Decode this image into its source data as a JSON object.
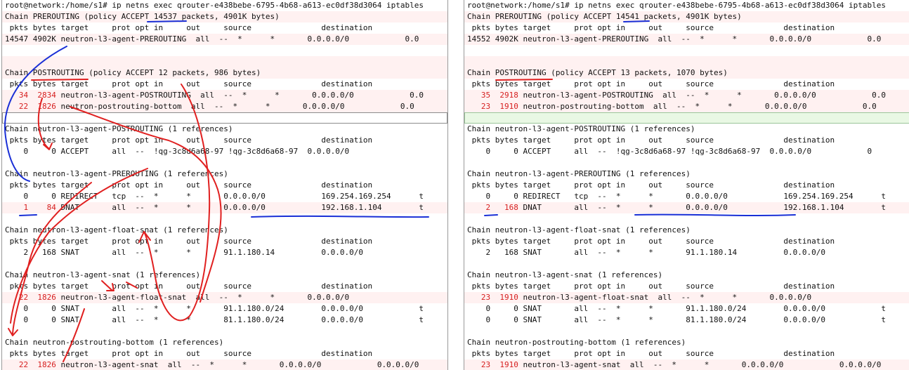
{
  "colors": {
    "row_alt": "#fff1f1",
    "text": "#111111",
    "red_numbers": "#d62020",
    "annotation_red": "#e02020",
    "annotation_blue": "#1a2fd6",
    "cursor_green": "#e9f8e4"
  },
  "left": {
    "lines": [
      "root@network:/home/s1# ip netns exec qrouter-e438bebe-6795-4b68-a613-ec0df38d3064 iptables",
      "Chain PREROUTING (policy ACCEPT 14537 packets, 4901K bytes)",
      " pkts bytes target     prot opt in     out     source               destination",
      "14547 4902K neutron-l3-agent-PREROUTING  all  --  *      *       0.0.0.0/0            0.0",
      "",
      "",
      "Chain POSTROUTING (policy ACCEPT 12 packets, 986 bytes)",
      " pkts bytes target     prot opt in     out     source               destination",
      "   34  2834 neutron-l3-agent-POSTROUTING  all  --  *      *       0.0.0.0/0            0.0",
      "   22  1826 neutron-postrouting-bottom  all  --  *      *       0.0.0.0/0            0.0",
      "",
      "Chain neutron-l3-agent-POSTROUTING (1 references)",
      " pkts bytes target     prot opt in     out     source               destination",
      "    0     0 ACCEPT     all  --  !qg-3c8d6a68-97 !qg-3c8d6a68-97  0.0.0.0/0",
      "",
      "Chain neutron-l3-agent-PREROUTING (1 references)",
      " pkts bytes target     prot opt in     out     source               destination",
      "    0     0 REDIRECT   tcp  --  *      *       0.0.0.0/0            169.254.169.254      t",
      "    1    84 DNAT       all  --  *      *       0.0.0.0/0            192.168.1.104        t",
      "",
      "Chain neutron-l3-agent-float-snat (1 references)",
      " pkts bytes target     prot opt in     out     source               destination",
      "    2   168 SNAT       all  --  *      *       91.1.180.14          0.0.0.0/0",
      "",
      "Chain neutron-l3-agent-snat (1 references)",
      " pkts bytes target     prot opt in     out     source               destination",
      "   22  1826 neutron-l3-agent-float-snat  all  --  *      *       0.0.0.0/0",
      "    0     0 SNAT       all  --  *      *       91.1.180.0/24        0.0.0.0/0            t",
      "    0     0 SNAT       all  --  *      *       81.1.180.0/24        0.0.0.0/0            t",
      "",
      "Chain neutron-postrouting-bottom (1 references)",
      " pkts bytes target     prot opt in     out     source               destination",
      "   22  1826 neutron-l3-agent-snat  all  --  *      *       0.0.0.0/0            0.0.0.0/0"
    ]
  },
  "right": {
    "lines": [
      "root@network:/home/s1# ip netns exec qrouter-e438bebe-6795-4b68-a613-ec0df38d3064 iptables",
      "Chain PREROUTING (policy ACCEPT 14541 packets, 4901K bytes)",
      " pkts bytes target     prot opt in     out     source               destination",
      "14552 4902K neutron-l3-agent-PREROUTING  all  --  *      *       0.0.0.0/0            0.0",
      "",
      "",
      "Chain POSTROUTING (policy ACCEPT 13 packets, 1070 bytes)",
      " pkts bytes target     prot opt in     out     source               destination",
      "   35  2918 neutron-l3-agent-POSTROUTING  all  --  *      *       0.0.0.0/0            0.0",
      "   23  1910 neutron-postrouting-bottom  all  --  *      *       0.0.0.0/0            0.0",
      "",
      "Chain neutron-l3-agent-POSTROUTING (1 references)",
      " pkts bytes target     prot opt in     out     source               destination",
      "    0     0 ACCEPT     all  --  !qg-3c8d6a68-97 !qg-3c8d6a68-97  0.0.0.0/0            0",
      "",
      "Chain neutron-l3-agent-PREROUTING (1 references)",
      " pkts bytes target     prot opt in     out     source               destination",
      "    0     0 REDIRECT   tcp  --  *      *       0.0.0.0/0            169.254.169.254      t",
      "    2   168 DNAT       all  --  *      *       0.0.0.0/0            192.168.1.104        t",
      "",
      "Chain neutron-l3-agent-float-snat (1 references)",
      " pkts bytes target     prot opt in     out     source               destination",
      "    2   168 SNAT       all  --  *      *       91.1.180.14          0.0.0.0/0",
      "",
      "Chain neutron-l3-agent-snat (1 references)",
      " pkts bytes target     prot opt in     out     source               destination",
      "   23  1910 neutron-l3-agent-float-snat  all  --  *      *       0.0.0.0/0",
      "    0     0 SNAT       all  --  *      *       91.1.180.0/24        0.0.0.0/0            t",
      "    0     0 SNAT       all  --  *      *       81.1.180.0/24        0.0.0.0/0            t",
      "",
      "Chain neutron-postrouting-bottom (1 references)",
      " pkts bytes target     prot opt in     out     source               destination",
      "   23  1910 neutron-l3-agent-snat  all  --  *      *       0.0.0.0/0            0.0.0.0/0"
    ]
  }
}
